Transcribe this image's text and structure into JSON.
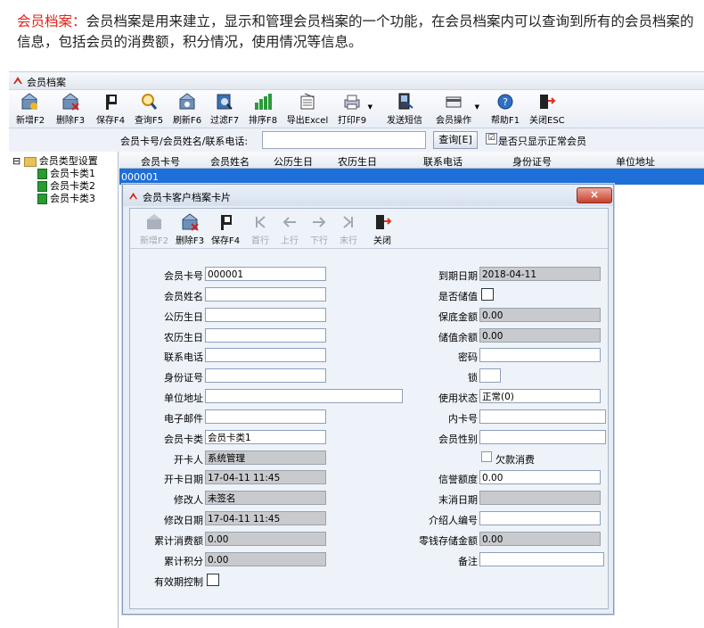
{
  "intro": {
    "highlight": "会员档案：",
    "text": "会员档案是用来建立，显示和管理会员档案的一个功能，在会员档案内可以查询到所有的会员档案的信息，包括会员的消费额，积分情况，使用情况等信息。"
  },
  "window": {
    "title": "会员档案"
  },
  "toolbar": [
    "新增F2",
    "删除F3",
    "保存F4",
    "查询F5",
    "刷新F6",
    "过滤F7",
    "排序F8",
    "导出Excel",
    "打印F9",
    "发送短信",
    "会员操作",
    "帮助F1",
    "关闭ESC"
  ],
  "search": {
    "label": "会员卡号/会员姓名/联系电话:",
    "value": "",
    "button": "查询[E]",
    "check_label": "是否只显示正常会员",
    "check_mark": "☑"
  },
  "tree": {
    "root": "会员类型设置",
    "items": [
      "会员卡类1",
      "会员卡类2",
      "会员卡类3"
    ],
    "toggle": "⊟"
  },
  "grid": {
    "columns": [
      "会员卡号",
      "会员姓名",
      "公历生日",
      "农历生日",
      "联系电话",
      "身份证号",
      "单位地址"
    ],
    "rows": [
      [
        "000001"
      ]
    ]
  },
  "dialog": {
    "title": "会员卡客户档案卡片",
    "close": "×",
    "toolbar": [
      "新增F2",
      "删除F3",
      "保存F4",
      "首行",
      "上行",
      "下行",
      "末行",
      "关闭"
    ],
    "left_fields": [
      {
        "label": "会员卡号",
        "value": "000001"
      },
      {
        "label": "会员姓名",
        "value": ""
      },
      {
        "label": "公历生日",
        "value": ""
      },
      {
        "label": "农历生日",
        "value": ""
      },
      {
        "label": "联系电话",
        "value": ""
      },
      {
        "label": "身份证号",
        "value": ""
      },
      {
        "label": "单位地址",
        "value": ""
      },
      {
        "label": "电子邮件",
        "value": ""
      },
      {
        "label": "会员卡类",
        "value": "会员卡类1"
      },
      {
        "label": "开卡人",
        "value": "系统管理"
      },
      {
        "label": "开卡日期",
        "value": "17-04-11 11:45"
      },
      {
        "label": "修改人",
        "value": "未签名"
      },
      {
        "label": "修改日期",
        "value": "17-04-11 11:45"
      },
      {
        "label": "累计消费额",
        "value": "0.00"
      },
      {
        "label": "累计积分",
        "value": "0.00"
      },
      {
        "label": "有效期控制",
        "value": ""
      }
    ],
    "right_fields": [
      {
        "label": "到期日期",
        "value": "2018-04-11"
      },
      {
        "label": "是否储值",
        "value": ""
      },
      {
        "label": "保底金额",
        "value": "0.00"
      },
      {
        "label": "储值余额",
        "value": "0.00"
      },
      {
        "label": "密码",
        "value": ""
      },
      {
        "label": "锁",
        "value": ""
      },
      {
        "label": "使用状态",
        "value": "正常(0)"
      },
      {
        "label": "内卡号",
        "value": ""
      },
      {
        "label": "会员性别",
        "value": ""
      },
      {
        "label": "欠款消费",
        "value": ""
      },
      {
        "label": "信誉额度",
        "value": "0.00"
      },
      {
        "label": "末消日期",
        "value": ""
      },
      {
        "label": "介绍人编号",
        "value": ""
      },
      {
        "label": "零钱存储金额",
        "value": "0.00"
      },
      {
        "label": "备注",
        "value": ""
      }
    ]
  },
  "colors": {
    "highlight": "#e0251b",
    "selection": "#1e6fd8",
    "readonly": "#c8cacd",
    "close": "#c8402c"
  }
}
